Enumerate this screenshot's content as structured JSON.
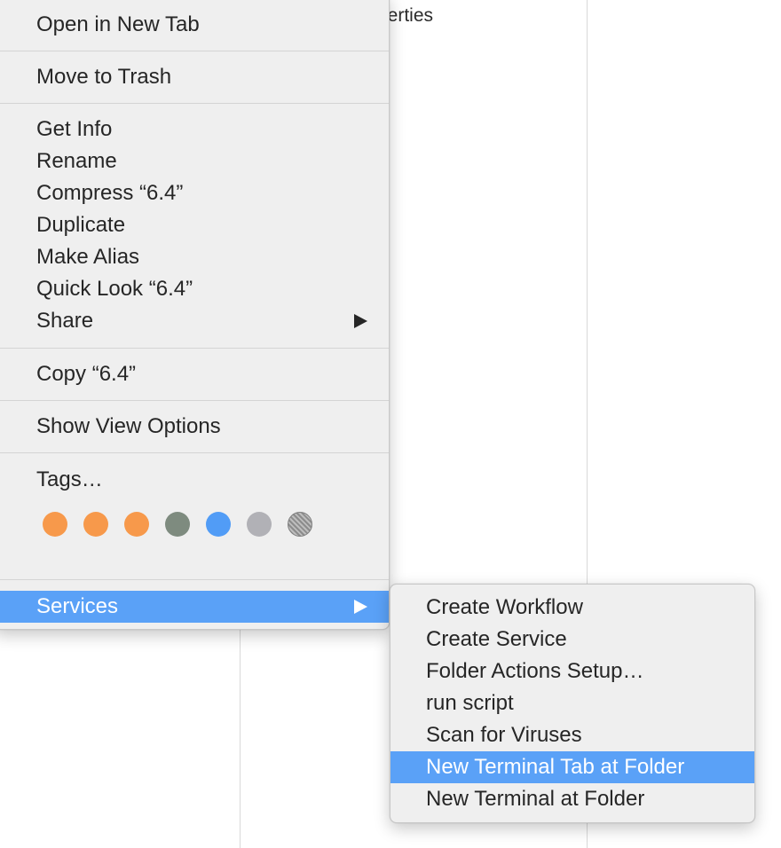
{
  "background": {
    "column_label": "perties"
  },
  "context_menu": {
    "items": [
      {
        "label": "Open in New Tab"
      },
      {
        "label": "Move to Trash"
      },
      {
        "label": "Get Info"
      },
      {
        "label": "Rename"
      },
      {
        "label": "Compress “6.4”"
      },
      {
        "label": "Duplicate"
      },
      {
        "label": "Make Alias"
      },
      {
        "label": "Quick Look “6.4”"
      },
      {
        "label": "Share",
        "has_submenu": true
      },
      {
        "label": "Copy “6.4”"
      },
      {
        "label": "Show View Options"
      },
      {
        "label": "Tags…"
      },
      {
        "label": "Services",
        "has_submenu": true,
        "highlighted": true
      }
    ],
    "tag_colors": [
      {
        "name": "orange",
        "color": "#f7994b"
      },
      {
        "name": "orange",
        "color": "#f7994b"
      },
      {
        "name": "orange",
        "color": "#f7994b"
      },
      {
        "name": "gray-green",
        "color": "#7e8b7f"
      },
      {
        "name": "blue",
        "color": "#519cf6"
      },
      {
        "name": "gray",
        "color": "#b1b1b6"
      },
      {
        "name": "all-tags",
        "color": "#9a9a9a"
      }
    ],
    "highlight_color": "#5aa1f7"
  },
  "services_menu": {
    "items": [
      {
        "label": "Create Workflow"
      },
      {
        "label": "Create Service"
      },
      {
        "label": "Folder Actions Setup…"
      },
      {
        "label": "run script"
      },
      {
        "label": "Scan for Viruses"
      },
      {
        "label": "New Terminal Tab at Folder",
        "highlighted": true
      },
      {
        "label": "New Terminal at Folder"
      }
    ]
  }
}
